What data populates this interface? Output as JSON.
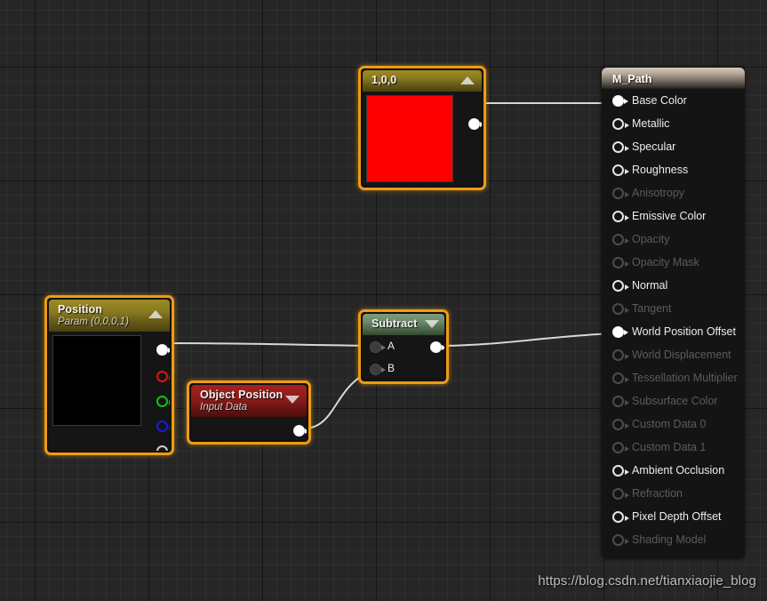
{
  "editor": {
    "name": "unreal-material-graph",
    "background_color": "#262626",
    "grid_minor_color": "#2e2e2e",
    "grid_major_color": "#141414",
    "selection_color": "#ee9b13",
    "wire_color": "#d8d8d8"
  },
  "watermark": {
    "text": "https://blog.csdn.net/tianxiaojie_blog"
  },
  "nodes": {
    "constant_vector": {
      "title": "1,0,0",
      "subtitle": "",
      "header_color": "#8a7a1f",
      "swatch_color": "#ff0000",
      "collapse_icon": "triangle-up",
      "selected": true,
      "outputs": [
        {
          "label": "",
          "style": "filled"
        }
      ]
    },
    "position": {
      "title": "Position",
      "subtitle": "Param (0,0,0,1)",
      "header_color": "#8a7a1f",
      "swatch_color": "#000000",
      "collapse_icon": "triangle-up",
      "selected": true,
      "outputs": [
        {
          "label": "",
          "style": "filled"
        },
        {
          "label": "",
          "style": "red"
        },
        {
          "label": "",
          "style": "green"
        },
        {
          "label": "",
          "style": "blue"
        },
        {
          "label": "",
          "style": "gray"
        }
      ]
    },
    "object_position": {
      "title": "Object Position",
      "subtitle": "Input Data",
      "header_color": "#8e1c1a",
      "collapse_icon": "triangle-down",
      "selected": true,
      "outputs": [
        {
          "label": "",
          "style": "filled"
        }
      ]
    },
    "subtract": {
      "title": "Subtract",
      "subtitle": "",
      "header_color": "#6d8a6b",
      "collapse_icon": "triangle-down",
      "selected": true,
      "inputs": [
        {
          "label": "A",
          "style": "dark"
        },
        {
          "label": "B",
          "style": "dark"
        }
      ],
      "outputs": [
        {
          "label": "",
          "style": "filled"
        }
      ]
    },
    "material_result": {
      "title": "M_Path",
      "header_color": "#bdb0a0",
      "pins": [
        {
          "label": "Base Color",
          "enabled": true,
          "connected": true
        },
        {
          "label": "Metallic",
          "enabled": true,
          "connected": false
        },
        {
          "label": "Specular",
          "enabled": true,
          "connected": false
        },
        {
          "label": "Roughness",
          "enabled": true,
          "connected": false
        },
        {
          "label": "Anisotropy",
          "enabled": false,
          "connected": false
        },
        {
          "label": "Emissive Color",
          "enabled": true,
          "connected": false
        },
        {
          "label": "Opacity",
          "enabled": false,
          "connected": false
        },
        {
          "label": "Opacity Mask",
          "enabled": false,
          "connected": false
        },
        {
          "label": "Normal",
          "enabled": true,
          "connected": false
        },
        {
          "label": "Tangent",
          "enabled": false,
          "connected": false
        },
        {
          "label": "World Position Offset",
          "enabled": true,
          "connected": true
        },
        {
          "label": "World Displacement",
          "enabled": false,
          "connected": false
        },
        {
          "label": "Tessellation Multiplier",
          "enabled": false,
          "connected": false
        },
        {
          "label": "Subsurface Color",
          "enabled": false,
          "connected": false
        },
        {
          "label": "Custom Data 0",
          "enabled": false,
          "connected": false
        },
        {
          "label": "Custom Data 1",
          "enabled": false,
          "connected": false
        },
        {
          "label": "Ambient Occlusion",
          "enabled": true,
          "connected": false
        },
        {
          "label": "Refraction",
          "enabled": false,
          "connected": false
        },
        {
          "label": "Pixel Depth Offset",
          "enabled": true,
          "connected": false
        },
        {
          "label": "Shading Model",
          "enabled": false,
          "connected": false
        }
      ]
    }
  },
  "connections": [
    {
      "from": "constant_vector.out",
      "to": "material_result.base_color"
    },
    {
      "from": "position.rgba",
      "to": "subtract.a"
    },
    {
      "from": "object_position.out",
      "to": "subtract.b"
    },
    {
      "from": "subtract.out",
      "to": "material_result.world_position_offset"
    }
  ]
}
